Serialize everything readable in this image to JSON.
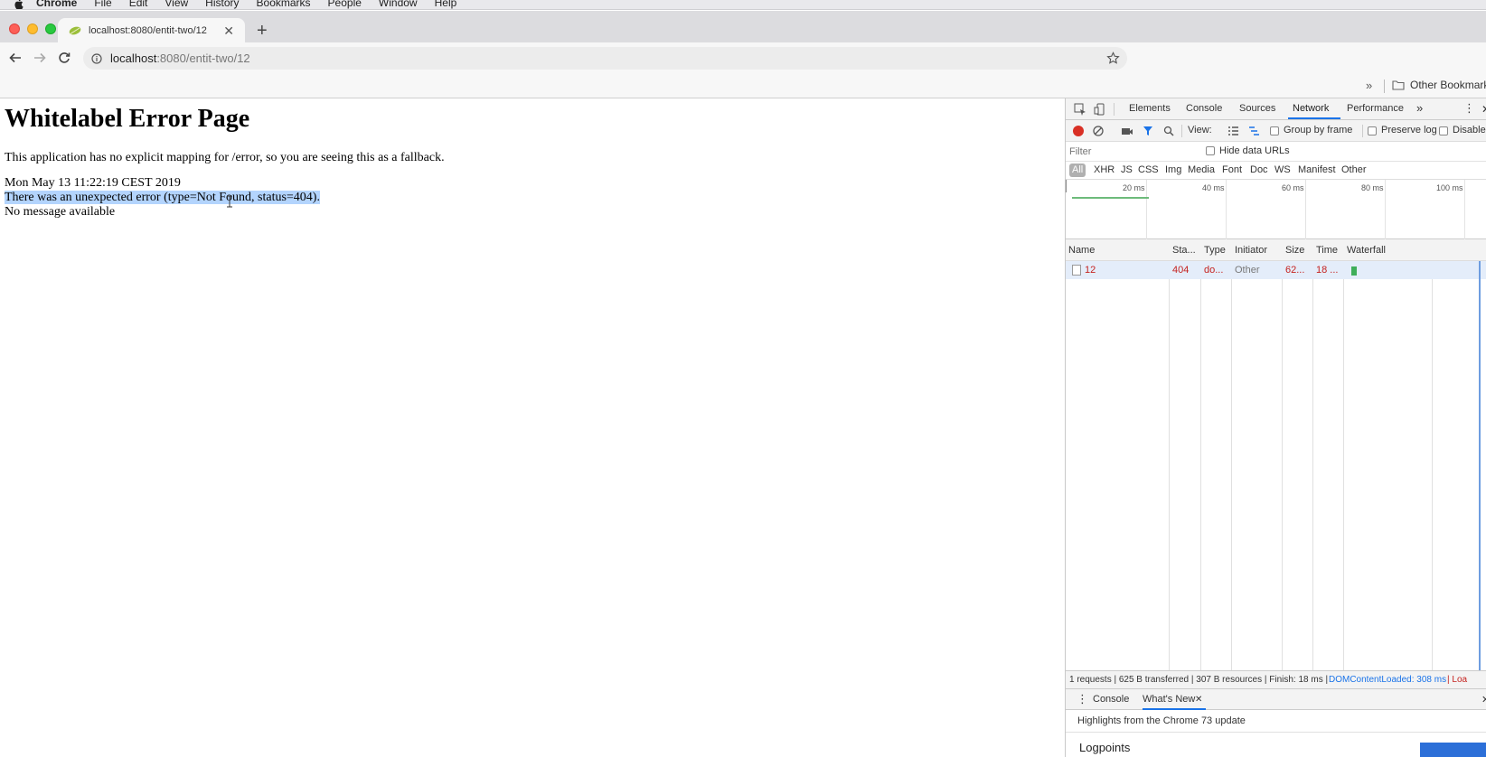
{
  "menubar": {
    "app": "Chrome",
    "items": [
      "File",
      "Edit",
      "View",
      "History",
      "Bookmarks",
      "People",
      "Window",
      "Help"
    ]
  },
  "browser": {
    "tab_title": "localhost:8080/entit-two/12",
    "url_host": "localhost",
    "url_path": ":8080/entit-two/12",
    "other_bookmarks": "Other Bookmarks",
    "bookmarks_chevron": "»"
  },
  "page": {
    "heading": "Whitelabel Error Page",
    "message": "This application has no explicit mapping for /error, so you are seeing this as a fallback.",
    "timestamp": "Mon May 13 11:22:19 CEST 2019",
    "error_line": "There was an unexpected error (type=Not Found, status=404).",
    "no_message": "No message available"
  },
  "devtools": {
    "tabs": [
      "Elements",
      "Console",
      "Sources",
      "Network",
      "Performance"
    ],
    "active_tab": "Network",
    "more_tabs": "»",
    "controls": {
      "view_label": "View:",
      "group_by_frame": "Group by frame",
      "preserve_log": "Preserve log",
      "disable_cache": "Disable"
    },
    "filter": {
      "placeholder": "Filter",
      "hide_data_urls": "Hide data URLs"
    },
    "types": [
      "All",
      "XHR",
      "JS",
      "CSS",
      "Img",
      "Media",
      "Font",
      "Doc",
      "WS",
      "Manifest",
      "Other"
    ],
    "overview_ticks": [
      "20 ms",
      "40 ms",
      "60 ms",
      "80 ms",
      "100 ms"
    ],
    "columns": [
      "Name",
      "Sta...",
      "Type",
      "Initiator",
      "Size",
      "Time",
      "Waterfall"
    ],
    "rows": [
      {
        "name": "12",
        "status": "404",
        "type": "do...",
        "initiator": "Other",
        "size": "62...",
        "time": "18 ..."
      }
    ],
    "summary": {
      "stats": "1 requests | 625 B transferred | 307 B resources | Finish: 18 ms |",
      "dom_content_loaded": "DOMContentLoaded: 308 ms",
      "load": "| Loa"
    },
    "drawer": {
      "tabs": [
        "Console",
        "What's New"
      ],
      "active": "What's New",
      "highlights": "Highlights from the Chrome 73 update",
      "logpoints": "Logpoints"
    }
  },
  "colors": {
    "record": "#d93025",
    "selection": "#b3d4fd",
    "error_text": "#c5221f",
    "accent": "#1a73e8"
  }
}
